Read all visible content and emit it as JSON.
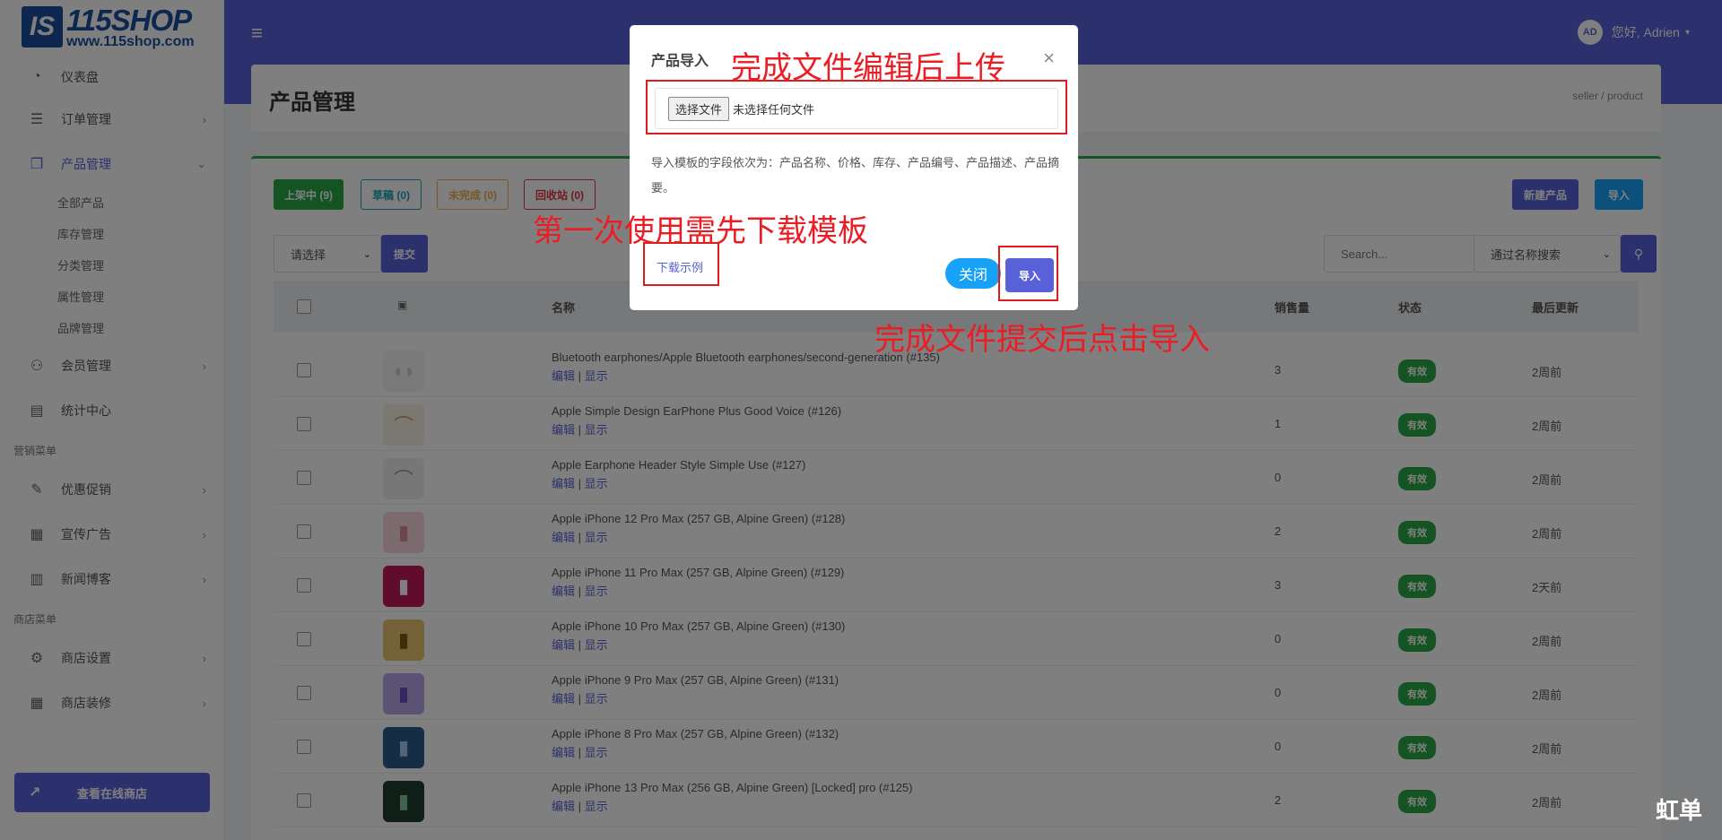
{
  "brand": {
    "logo_mark": "IS",
    "name": "115SHOP",
    "url": "www.115shop.com"
  },
  "sidebar": {
    "dashboard": "仪表盘",
    "orders": "订单管理",
    "products": "产品管理",
    "product_sub": [
      "全部产品",
      "库存管理",
      "分类管理",
      "属性管理",
      "品牌管理"
    ],
    "members": "会员管理",
    "stats": "统计中心",
    "marketing_section": "营销菜单",
    "promotions": "优惠促销",
    "ads": "宣传广告",
    "news": "新闻博客",
    "store_section": "商店菜单",
    "store_settings": "商店设置",
    "store_decor": "商店装修",
    "view_store": "查看在线商店"
  },
  "topbar": {
    "avatar": "AD",
    "greeting": "您好, Adrien"
  },
  "page": {
    "title": "产品管理",
    "breadcrumb": "seller  /  product"
  },
  "tabs": {
    "on_sale": "上架中 (9)",
    "draft": "草稿 (0)",
    "incomplete": "未完成 (0)",
    "recycle": "回收站 (0)"
  },
  "actions": {
    "new_product": "新建产品",
    "import": "导入",
    "bulk_select": "请选择",
    "submit": "提交",
    "search_placeholder": "Search...",
    "search_mode": "通过名称搜索"
  },
  "table": {
    "headers": {
      "name": "名称",
      "sales": "销售量",
      "status": "状态",
      "updated": "最后更新"
    },
    "edit": "编辑",
    "show": "显示",
    "rows": [
      {
        "name": "Bluetooth earphones/Apple Bluetooth earphones/second-generation (#135)",
        "sales": "3",
        "status": "有效",
        "updated": "2周前"
      },
      {
        "name": "Apple Simple Design EarPhone Plus Good Voice (#126)",
        "sales": "1",
        "status": "有效",
        "updated": "2周前"
      },
      {
        "name": "Apple Earphone Header Style Simple Use (#127)",
        "sales": "0",
        "status": "有效",
        "updated": "2周前"
      },
      {
        "name": "Apple iPhone 12 Pro Max (257 GB, Alpine Green) (#128)",
        "sales": "2",
        "status": "有效",
        "updated": "2周前"
      },
      {
        "name": "Apple iPhone 11 Pro Max (257 GB, Alpine Green) (#129)",
        "sales": "3",
        "status": "有效",
        "updated": "2天前"
      },
      {
        "name": "Apple iPhone 10 Pro Max (257 GB, Alpine Green) (#130)",
        "sales": "0",
        "status": "有效",
        "updated": "2周前"
      },
      {
        "name": "Apple iPhone 9 Pro Max (257 GB, Alpine Green) (#131)",
        "sales": "0",
        "status": "有效",
        "updated": "2周前"
      },
      {
        "name": "Apple iPhone 8 Pro Max (257 GB, Alpine Green) (#132)",
        "sales": "0",
        "status": "有效",
        "updated": "2周前"
      },
      {
        "name": "Apple iPhone 13 Pro Max (256 GB, Alpine Green) [Locked] pro (#125)",
        "sales": "2",
        "status": "有效",
        "updated": "2周前"
      }
    ]
  },
  "modal": {
    "title": "产品导入",
    "close_x": "×",
    "file_button": "选择文件",
    "file_status": "未选择任何文件",
    "hint": "导入模板的字段依次为：产品名称、价格、库存、产品编号、产品描述、产品摘要。",
    "download": "下载示例",
    "close": "关闭",
    "import": "导入"
  },
  "annotations": {
    "upload": "完成文件编辑后上传",
    "template": "第一次使用需先下载模板",
    "submit": "完成文件提交后点击导入"
  },
  "watermark": "虹单",
  "colors": {
    "primary": "#5961d8",
    "success": "#28a745",
    "info": "#17a2f8",
    "annotation": "#ec1c24"
  }
}
